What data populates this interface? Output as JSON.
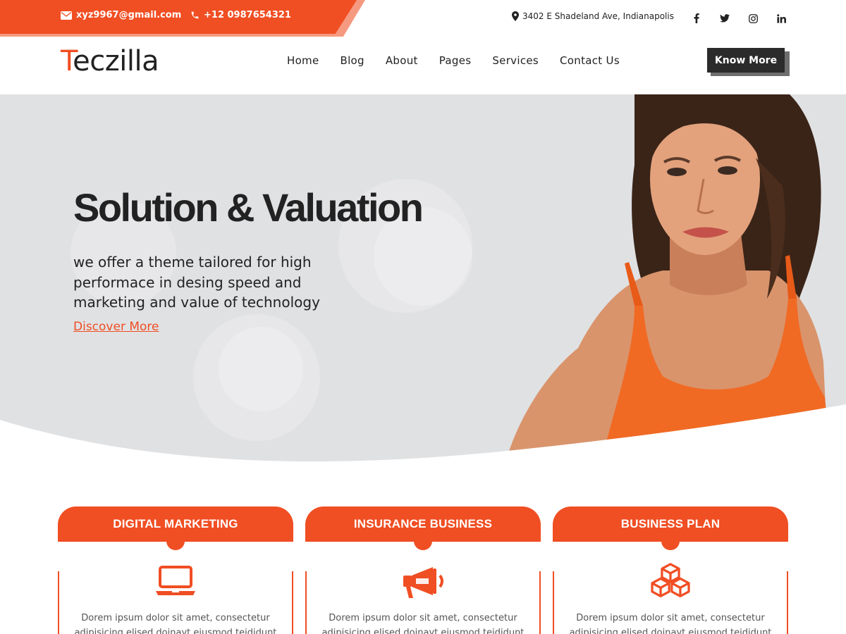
{
  "topbar": {
    "email": "xyz9967@gmail.com",
    "phone": "+12 0987654321",
    "address": "3402 E Shadeland Ave, Indianapolis",
    "socials": [
      {
        "name": "facebook",
        "glyph": "f"
      },
      {
        "name": "twitter",
        "glyph": "twitter-bird"
      },
      {
        "name": "instagram",
        "glyph": "instagram"
      },
      {
        "name": "linkedin",
        "glyph": "in"
      }
    ],
    "colors": {
      "accent": "#f04e23",
      "accent_light": "#f59a80"
    }
  },
  "header": {
    "logo_first": "T",
    "logo_rest": "eczilla",
    "nav": [
      "Home",
      "Blog",
      "About",
      "Pages",
      "Services",
      "Contact Us"
    ],
    "cta_label": "Know More"
  },
  "hero": {
    "title": "Solution & Valuation",
    "text": "we offer a theme tailored for high performace in desing speed and marketing and value of technology",
    "link": "Discover More",
    "background": "#e0e1e3"
  },
  "services": [
    {
      "title": "DIGITAL MARKETING",
      "icon": "laptop-icon",
      "text": "Dorem ipsum dolor sit amet, consectetur adipisicing elised doinayt eiusmod teididunt ut"
    },
    {
      "title": "INSURANCE BUSINESS",
      "icon": "megaphone-icon",
      "text": "Dorem ipsum dolor sit amet, consectetur adipisicing elised doinayt eiusmod teididunt ut"
    },
    {
      "title": "BUSINESS PLAN",
      "icon": "cubes-icon",
      "text": "Dorem ipsum dolor sit amet, consectetur adipisicing elised doinayt eiusmod teididunt ut"
    }
  ]
}
